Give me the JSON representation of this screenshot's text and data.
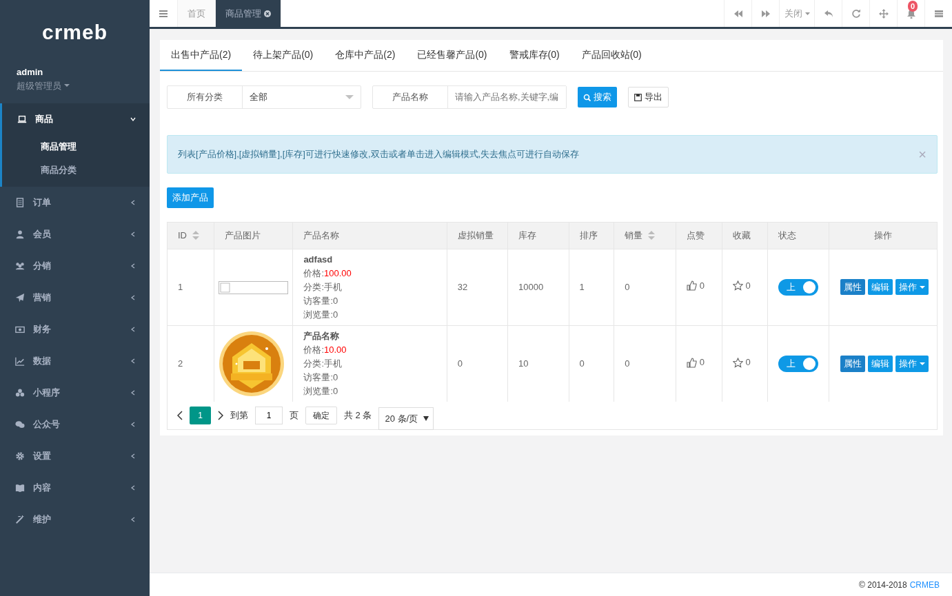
{
  "sidebar": {
    "logo": "crmeb",
    "user": {
      "name": "admin",
      "role": "超级管理员"
    },
    "menu": [
      {
        "label": "商品",
        "expanded": true,
        "children": [
          {
            "label": "商品管理",
            "selected": true
          },
          {
            "label": "商品分类",
            "selected": false
          }
        ]
      },
      {
        "label": "订单",
        "expanded": false
      },
      {
        "label": "会员",
        "expanded": false
      },
      {
        "label": "分销",
        "expanded": false
      },
      {
        "label": "营销",
        "expanded": false
      },
      {
        "label": "财务",
        "expanded": false
      },
      {
        "label": "数据",
        "expanded": false
      },
      {
        "label": "小程序",
        "expanded": false
      },
      {
        "label": "公众号",
        "expanded": false
      },
      {
        "label": "设置",
        "expanded": false
      },
      {
        "label": "内容",
        "expanded": false
      },
      {
        "label": "维护",
        "expanded": false
      }
    ]
  },
  "topbar": {
    "tabs": [
      {
        "label": "首页",
        "selected": false,
        "closable": false
      },
      {
        "label": "商品管理",
        "selected": true,
        "closable": true
      }
    ],
    "tools": [
      {
        "kind": "back"
      },
      {
        "kind": "forward"
      },
      {
        "kind": "text",
        "label": "关闭"
      },
      {
        "kind": "reply"
      },
      {
        "kind": "refresh"
      },
      {
        "kind": "move"
      },
      {
        "kind": "bell",
        "badge": "0"
      },
      {
        "kind": "list"
      }
    ]
  },
  "product_tabs": [
    {
      "label": "出售中产品(2)",
      "selected": true
    },
    {
      "label": "待上架产品(0)",
      "selected": false
    },
    {
      "label": "仓库中产品(2)",
      "selected": false
    },
    {
      "label": "已经售馨产品(0)",
      "selected": false
    },
    {
      "label": "警戒库存(0)",
      "selected": false
    },
    {
      "label": "产品回收站(0)",
      "selected": false
    }
  ],
  "filters": {
    "category_label": "所有分类",
    "category_value": "全部",
    "name_label": "产品名称",
    "name_placeholder": "请输入产品名称,关键字,编",
    "search_button": "搜索",
    "export_button": "导出"
  },
  "alert": {
    "text": "列表[产品价格],[虚拟销量],[库存]可进行快速修改,双击或者单击进入编辑模式,失去焦点可进行自动保存",
    "close": "×"
  },
  "add_button": "添加产品",
  "table": {
    "columns": [
      {
        "label": "ID",
        "sortable": true
      },
      {
        "label": "产品图片",
        "sortable": false
      },
      {
        "label": "产品名称",
        "sortable": false
      },
      {
        "label": "虚拟销量",
        "sortable": false
      },
      {
        "label": "库存",
        "sortable": false
      },
      {
        "label": "排序",
        "sortable": false
      },
      {
        "label": "销量",
        "sortable": true
      },
      {
        "label": "点赞",
        "sortable": false
      },
      {
        "label": "收藏",
        "sortable": false
      },
      {
        "label": "状态",
        "sortable": false
      },
      {
        "label": "操作",
        "sortable": false
      }
    ],
    "rows": [
      {
        "id": "1",
        "image": {
          "kind": "broken"
        },
        "name": "adfasd",
        "price_label": "价格:",
        "price": "100.00",
        "category": "分类:手机",
        "visitors": "访客量:0",
        "views": "浏览量:0",
        "virtual_sales": "32",
        "stock": "10000",
        "sort": "1",
        "sales": "0",
        "likes": "0",
        "favorites": "0",
        "status": {
          "label": "上",
          "on": true
        },
        "actions": [
          {
            "label": "属性",
            "kind": "plain",
            "color": "#1b80c8"
          },
          {
            "label": "编辑",
            "kind": "plain",
            "color": "#0e99e6"
          },
          {
            "label": "操作",
            "kind": "dropdown",
            "color": "#0e99e6"
          }
        ]
      },
      {
        "id": "2",
        "name": "产品名称",
        "price_label": "价格:",
        "price": "10.00",
        "category": "分类:手机",
        "visitors": "访客量:0",
        "views": "浏览量:0",
        "virtual_sales": "0",
        "stock": "10",
        "sort": "0",
        "sales": "0",
        "likes": "0",
        "favorites": "0",
        "status": {
          "label": "上",
          "on": true
        },
        "actions": [
          {
            "label": "属性",
            "kind": "plain",
            "color": "#1b80c8"
          },
          {
            "label": "编辑",
            "kind": "plain",
            "color": "#0e99e6"
          },
          {
            "label": "操作",
            "kind": "dropdown",
            "color": "#0e99e6"
          }
        ]
      }
    ]
  },
  "pagination": {
    "pages": [
      {
        "label": "1",
        "selected": true
      }
    ],
    "goto_label": "到第",
    "goto_value": "1",
    "page_unit": "页",
    "confirm": "确定",
    "total": "共 2 条",
    "page_size": "20 条/页"
  },
  "footer": {
    "copyright": "© 2014-2018",
    "brand": "CRMEB"
  }
}
